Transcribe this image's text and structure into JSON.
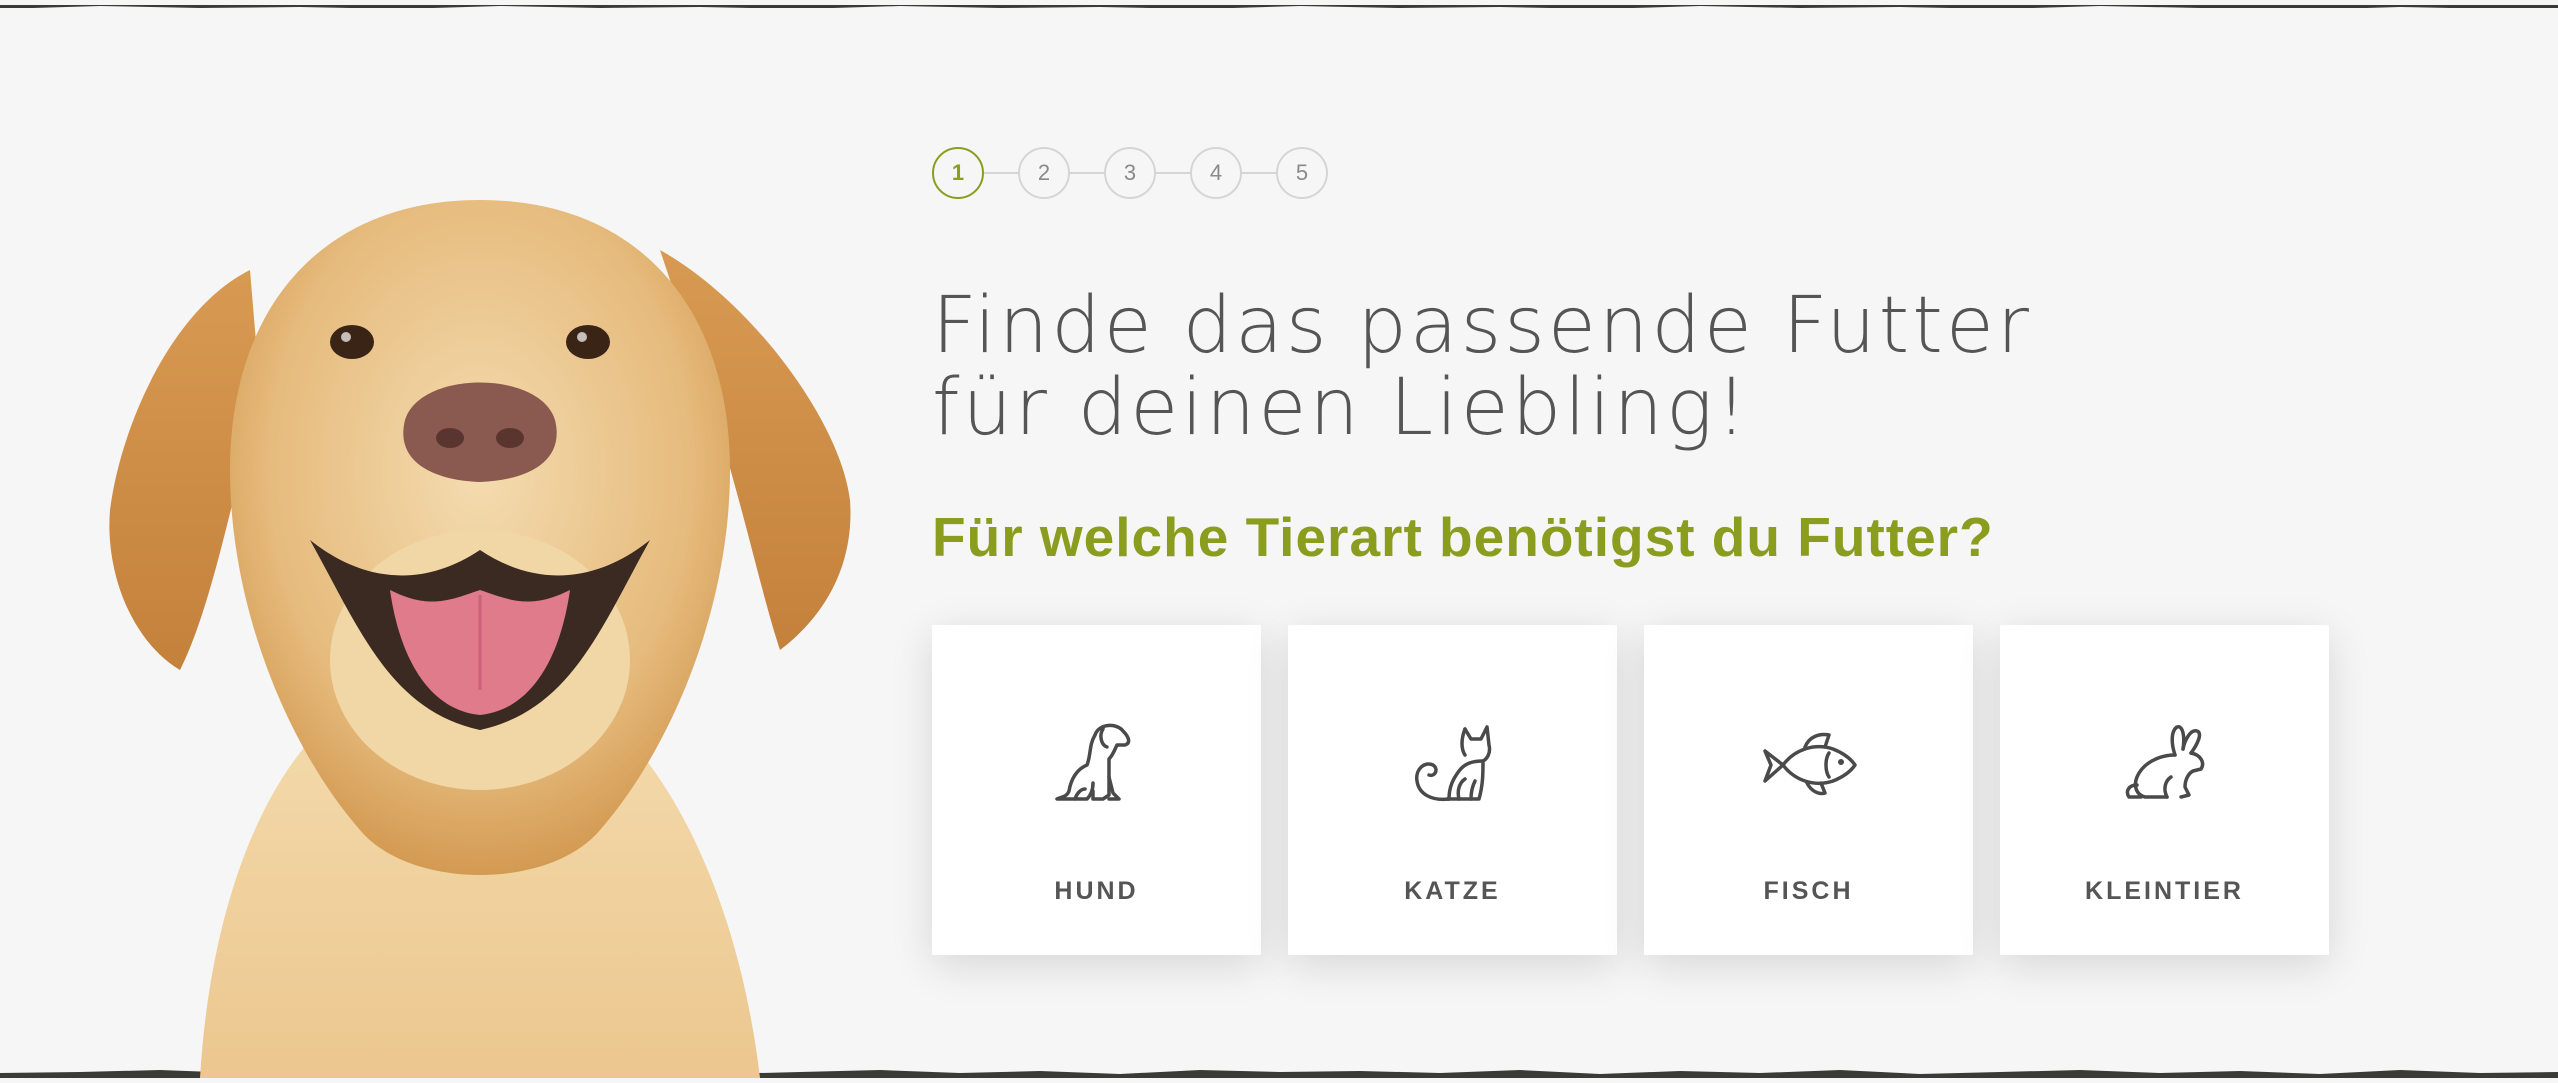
{
  "stepper": {
    "steps": [
      {
        "label": "1",
        "active": true
      },
      {
        "label": "2",
        "active": false
      },
      {
        "label": "3",
        "active": false
      },
      {
        "label": "4",
        "active": false
      },
      {
        "label": "5",
        "active": false
      }
    ]
  },
  "hero": {
    "title_line1": "Finde das passende Futter",
    "title_line2": "für deinen Liebling!",
    "question": "Für welche Tierart benötigst du Futter?"
  },
  "options": [
    {
      "label": "HUND",
      "icon": "dog-icon"
    },
    {
      "label": "KATZE",
      "icon": "cat-icon"
    },
    {
      "label": "FISCH",
      "icon": "fish-icon"
    },
    {
      "label": "KLEINTIER",
      "icon": "rabbit-icon"
    }
  ],
  "colors": {
    "accent": "#8a9d1e",
    "background": "#f6f6f6",
    "text": "#555555"
  }
}
